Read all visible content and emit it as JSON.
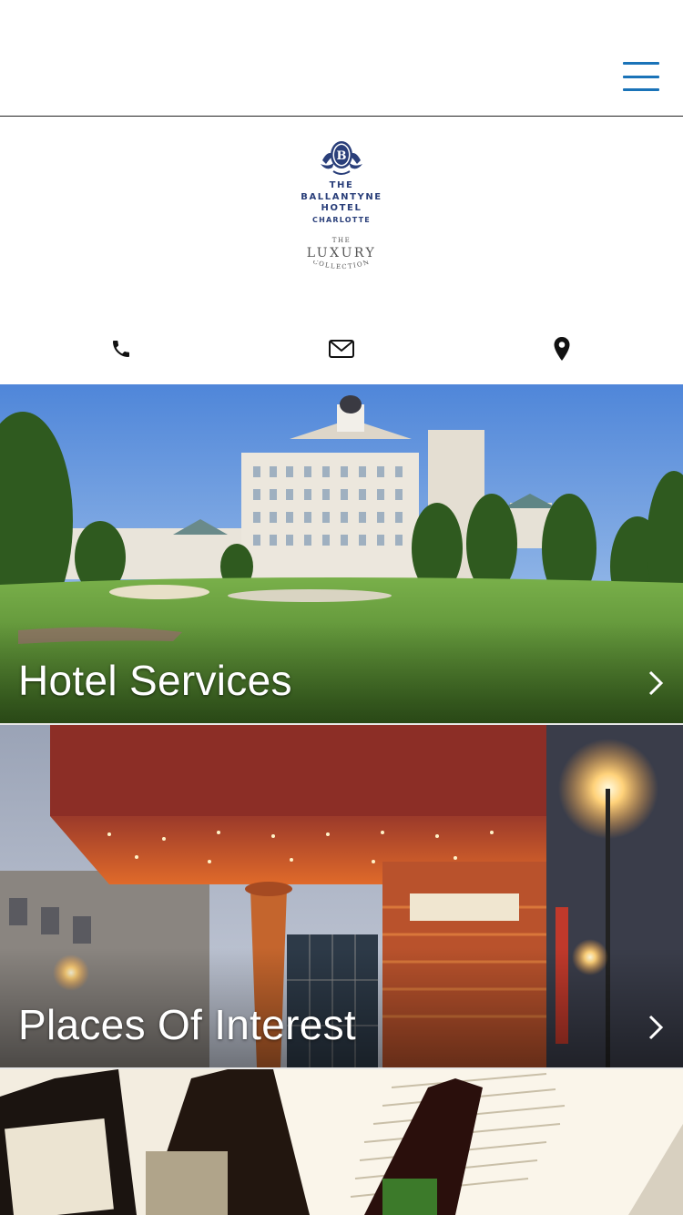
{
  "header": {
    "menu_icon": "hamburger-menu-icon",
    "accent_color": "#1a73b8"
  },
  "logo": {
    "hotel_name_line1": "THE",
    "hotel_name_line2": "BALLANTYNE",
    "hotel_name_line3": "HOTEL",
    "hotel_city": "CHARLOTTE",
    "brand_the": "THE",
    "brand_name": "LUXURY",
    "brand_collection": "COLLECTION",
    "brand_color": "#2a3f7a"
  },
  "contact": {
    "icons": [
      "phone-icon",
      "mail-icon",
      "map-pin-icon"
    ]
  },
  "panels": [
    {
      "title": "Hotel Services",
      "icon": "chevron-right-icon"
    },
    {
      "title": "Places Of Interest",
      "icon": "chevron-right-icon"
    },
    {
      "title": "",
      "icon": ""
    }
  ]
}
